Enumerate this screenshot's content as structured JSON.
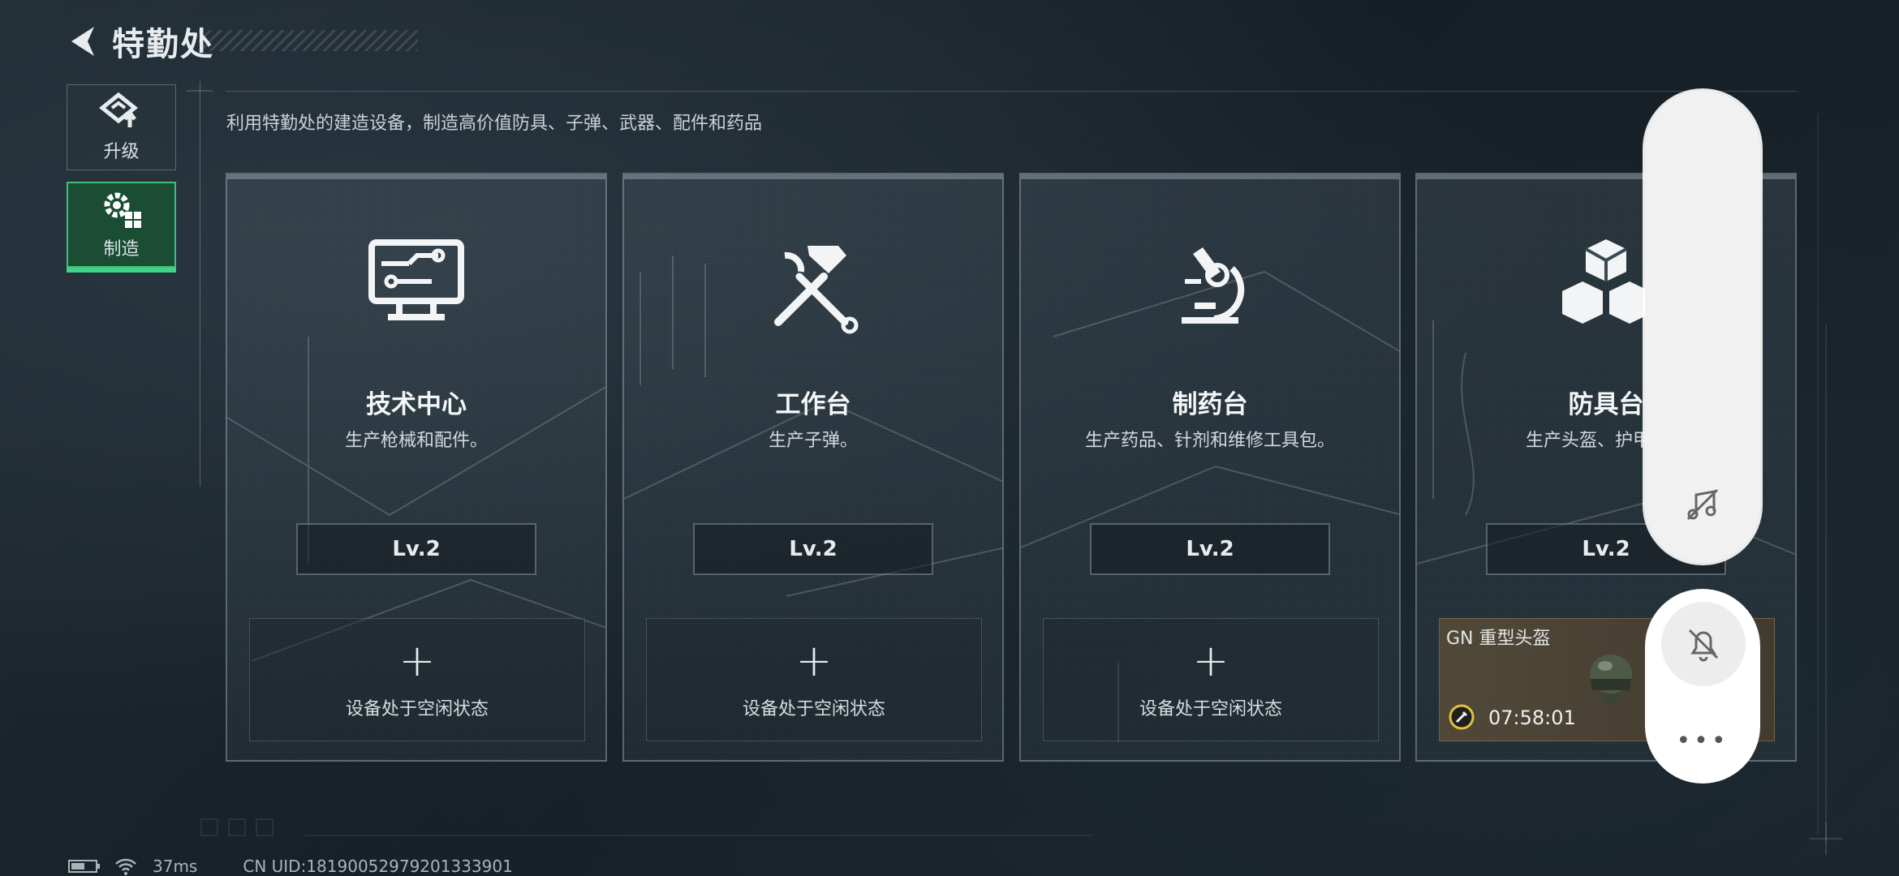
{
  "header": {
    "title": "特勤处"
  },
  "nav": [
    {
      "label": "升级",
      "icon": "upgrade-icon",
      "active": false
    },
    {
      "label": "制造",
      "icon": "craft-gear-icon",
      "active": true
    }
  ],
  "subtitle": "利用特勤处的建造设备，制造高价值防具、子弹、武器、配件和药品",
  "cards": [
    {
      "name": "技术中心",
      "desc": "生产枪械和配件。",
      "level": "Lv.2",
      "icon": "monitor-circuit-icon",
      "slot": {
        "plus": "+",
        "label": "设备处于空闲状态"
      }
    },
    {
      "name": "工作台",
      "desc": "生产子弹。",
      "level": "Lv.2",
      "icon": "hammer-wrench-icon",
      "slot": {
        "plus": "+",
        "label": "设备处于空闲状态"
      }
    },
    {
      "name": "制药台",
      "desc": "生产药品、针剂和维修工具包。",
      "level": "Lv.2",
      "icon": "microscope-icon",
      "slot": {
        "plus": "+",
        "label": "设备处于空闲状态"
      }
    },
    {
      "name": "防具台",
      "desc": "生产头盔、护甲、胸",
      "level": "Lv.2",
      "icon": "cubes-icon",
      "production": {
        "item": "GN 重型头盔",
        "timer": "07:58:01"
      }
    }
  ],
  "overlay": {
    "dots": "•••"
  },
  "status": {
    "ping": "37ms",
    "uid": "CN UID:18190052979201333901"
  },
  "colors": {
    "accent_green": "#3fd48a",
    "nav_active_bg": "#1a4d34",
    "timer_ring": "#e0c23a"
  }
}
